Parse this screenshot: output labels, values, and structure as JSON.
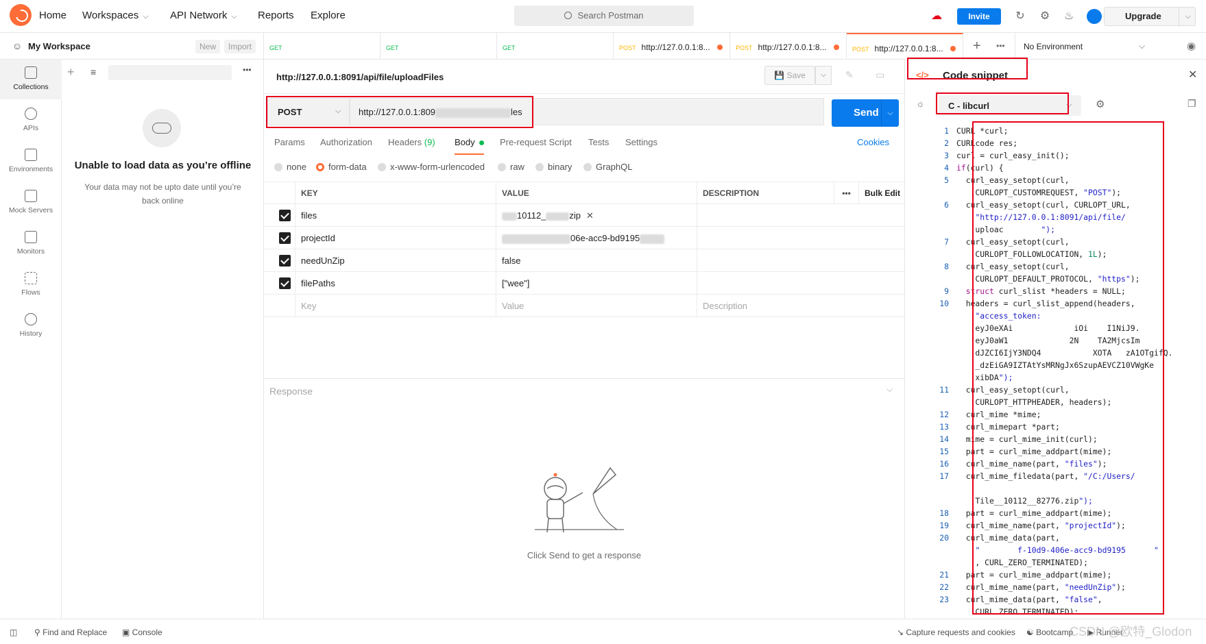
{
  "topbar": {
    "nav": [
      "Home",
      "Workspaces",
      "API Network",
      "Reports",
      "Explore"
    ],
    "search_placeholder": "Search Postman",
    "invite_label": "Invite",
    "upgrade_label": "Upgrade"
  },
  "workspace": {
    "name": "My Workspace",
    "new_label": "New",
    "import_label": "Import"
  },
  "rail": [
    {
      "label": "Collections",
      "icon": "collections-icon"
    },
    {
      "label": "APIs",
      "icon": "apis-icon"
    },
    {
      "label": "Environments",
      "icon": "environments-icon"
    },
    {
      "label": "Mock Servers",
      "icon": "mock-servers-icon"
    },
    {
      "label": "Monitors",
      "icon": "monitors-icon"
    },
    {
      "label": "Flows",
      "icon": "flows-icon"
    },
    {
      "label": "History",
      "icon": "history-icon"
    }
  ],
  "sidepanel": {
    "offline_title": "Unable to load data as you’re offline",
    "offline_sub": "Your data may not be upto date until you’re back online"
  },
  "tabs": [
    {
      "method": "GET",
      "url": ""
    },
    {
      "method": "GET",
      "url": ""
    },
    {
      "method": "GET",
      "url": ""
    },
    {
      "method": "POST",
      "url": "http://127.0.0.1:8..."
    },
    {
      "method": "POST",
      "url": "http://127.0.0.1:8..."
    },
    {
      "method": "POST",
      "url": "http://127.0.0.1:8..."
    }
  ],
  "environment": "No Environment",
  "request": {
    "title": "http://127.0.0.1:8091/api/file/uploadFiles",
    "save_label": "Save",
    "method": "POST",
    "url_start": "http://127.0.0.1:809",
    "url_end": "les",
    "send_label": "Send"
  },
  "reqtabs": {
    "params": "Params",
    "authorization": "Authorization",
    "headers": "Headers",
    "headers_count": "(9)",
    "body": "Body",
    "prerequest": "Pre-request Script",
    "tests": "Tests",
    "settings": "Settings",
    "cookies": "Cookies"
  },
  "body_types": [
    "none",
    "form-data",
    "x-www-form-urlencoded",
    "raw",
    "binary",
    "GraphQL"
  ],
  "table": {
    "headers": {
      "key": "KEY",
      "value": "VALUE",
      "description": "DESCRIPTION",
      "bulk": "Bulk Edit"
    },
    "rows": [
      {
        "key": "files",
        "value_a": "10112_",
        "value_b": "zip"
      },
      {
        "key": "projectId",
        "value_a": "",
        "value_b": "06e-acc9-bd9195"
      },
      {
        "key": "needUnZip",
        "value_a": "false",
        "value_b": ""
      },
      {
        "key": "filePaths",
        "value_a": "[\"wee\"]",
        "value_b": ""
      }
    ],
    "placeholder": {
      "key": "Key",
      "value": "Value",
      "description": "Description"
    }
  },
  "response": {
    "title": "Response",
    "hint": "Click Send to get a response"
  },
  "snippet": {
    "title": "Code snippet",
    "language": "C - libcurl",
    "lines": [
      {
        "n": "1",
        "t": "CURL *curl;"
      },
      {
        "n": "2",
        "t": "CURLcode res;"
      },
      {
        "n": "3",
        "t": "curl = curl_easy_init();"
      },
      {
        "n": "4",
        "t": "if(curl) {"
      },
      {
        "n": "5",
        "t": "  curl_easy_setopt(curl,"
      },
      {
        "n": "",
        "t": "    CURLOPT_CUSTOMREQUEST, \"POST\");"
      },
      {
        "n": "6",
        "t": "  curl_easy_setopt(curl, CURLOPT_URL,"
      },
      {
        "n": "",
        "t": "    \"http://127.0.0.1:8091/api/file/"
      },
      {
        "n": "",
        "t": "    uploac        \");"
      },
      {
        "n": "7",
        "t": "  curl_easy_setopt(curl,"
      },
      {
        "n": "",
        "t": "    CURLOPT_FOLLOWLOCATION, 1L);"
      },
      {
        "n": "8",
        "t": "  curl_easy_setopt(curl,"
      },
      {
        "n": "",
        "t": "    CURLOPT_DEFAULT_PROTOCOL, \"https\");"
      },
      {
        "n": "9",
        "t": "  struct curl_slist *headers = NULL;"
      },
      {
        "n": "10",
        "t": "  headers = curl_slist_append(headers,"
      },
      {
        "n": "",
        "t": "    \"access_token:"
      },
      {
        "n": "",
        "t": "    eyJ0eXAi             iOi    I1NiJ9."
      },
      {
        "n": "",
        "t": "    eyJ0aW1             2N    TA2MjcsIm"
      },
      {
        "n": "",
        "t": "    dJZCI6IjY3NDQ4           XOTA   zA1OTgifQ."
      },
      {
        "n": "",
        "t": "    _dzEiGA9IZTAtYsMRNgJx6SzupAEVCZ10VWgKe"
      },
      {
        "n": "",
        "t": "    xibDA\");"
      },
      {
        "n": "11",
        "t": "  curl_easy_setopt(curl,"
      },
      {
        "n": "",
        "t": "    CURLOPT_HTTPHEADER, headers);"
      },
      {
        "n": "12",
        "t": "  curl_mime *mime;"
      },
      {
        "n": "13",
        "t": "  curl_mimepart *part;"
      },
      {
        "n": "14",
        "t": "  mime = curl_mime_init(curl);"
      },
      {
        "n": "15",
        "t": "  part = curl_mime_addpart(mime);"
      },
      {
        "n": "16",
        "t": "  curl_mime_name(part, \"files\");"
      },
      {
        "n": "17",
        "t": "  curl_mime_filedata(part, \"/C:/Users/"
      },
      {
        "n": "",
        "t": "    "
      },
      {
        "n": "",
        "t": "    Tile__10112__82776.zip\");"
      },
      {
        "n": "18",
        "t": "  part = curl_mime_addpart(mime);"
      },
      {
        "n": "19",
        "t": "  curl_mime_name(part, \"projectId\");"
      },
      {
        "n": "20",
        "t": "  curl_mime_data(part,"
      },
      {
        "n": "",
        "t": "    \"        f-10d9-406e-acc9-bd9195      \""
      },
      {
        "n": "",
        "t": "    , CURL_ZERO_TERMINATED);"
      },
      {
        "n": "21",
        "t": "  part = curl_mime_addpart(mime);"
      },
      {
        "n": "22",
        "t": "  curl_mime_name(part, \"needUnZip\");"
      },
      {
        "n": "23",
        "t": "  curl_mime_data(part, \"false\","
      },
      {
        "n": "",
        "t": "    CURL_ZERO_TERMINATED);"
      }
    ]
  },
  "statusbar": {
    "find": "Find and Replace",
    "console": "Console",
    "capture": "Capture requests and cookies",
    "bootcamp": "Bootcamp",
    "runner": "Runner",
    "watermark": "CSDN @欧特_Glodon"
  },
  "colors": {
    "accent": "#ff6c37",
    "primary": "#097bed",
    "annotation": "#e6001a",
    "get": "#0cbb52",
    "post": "#ffb400"
  }
}
